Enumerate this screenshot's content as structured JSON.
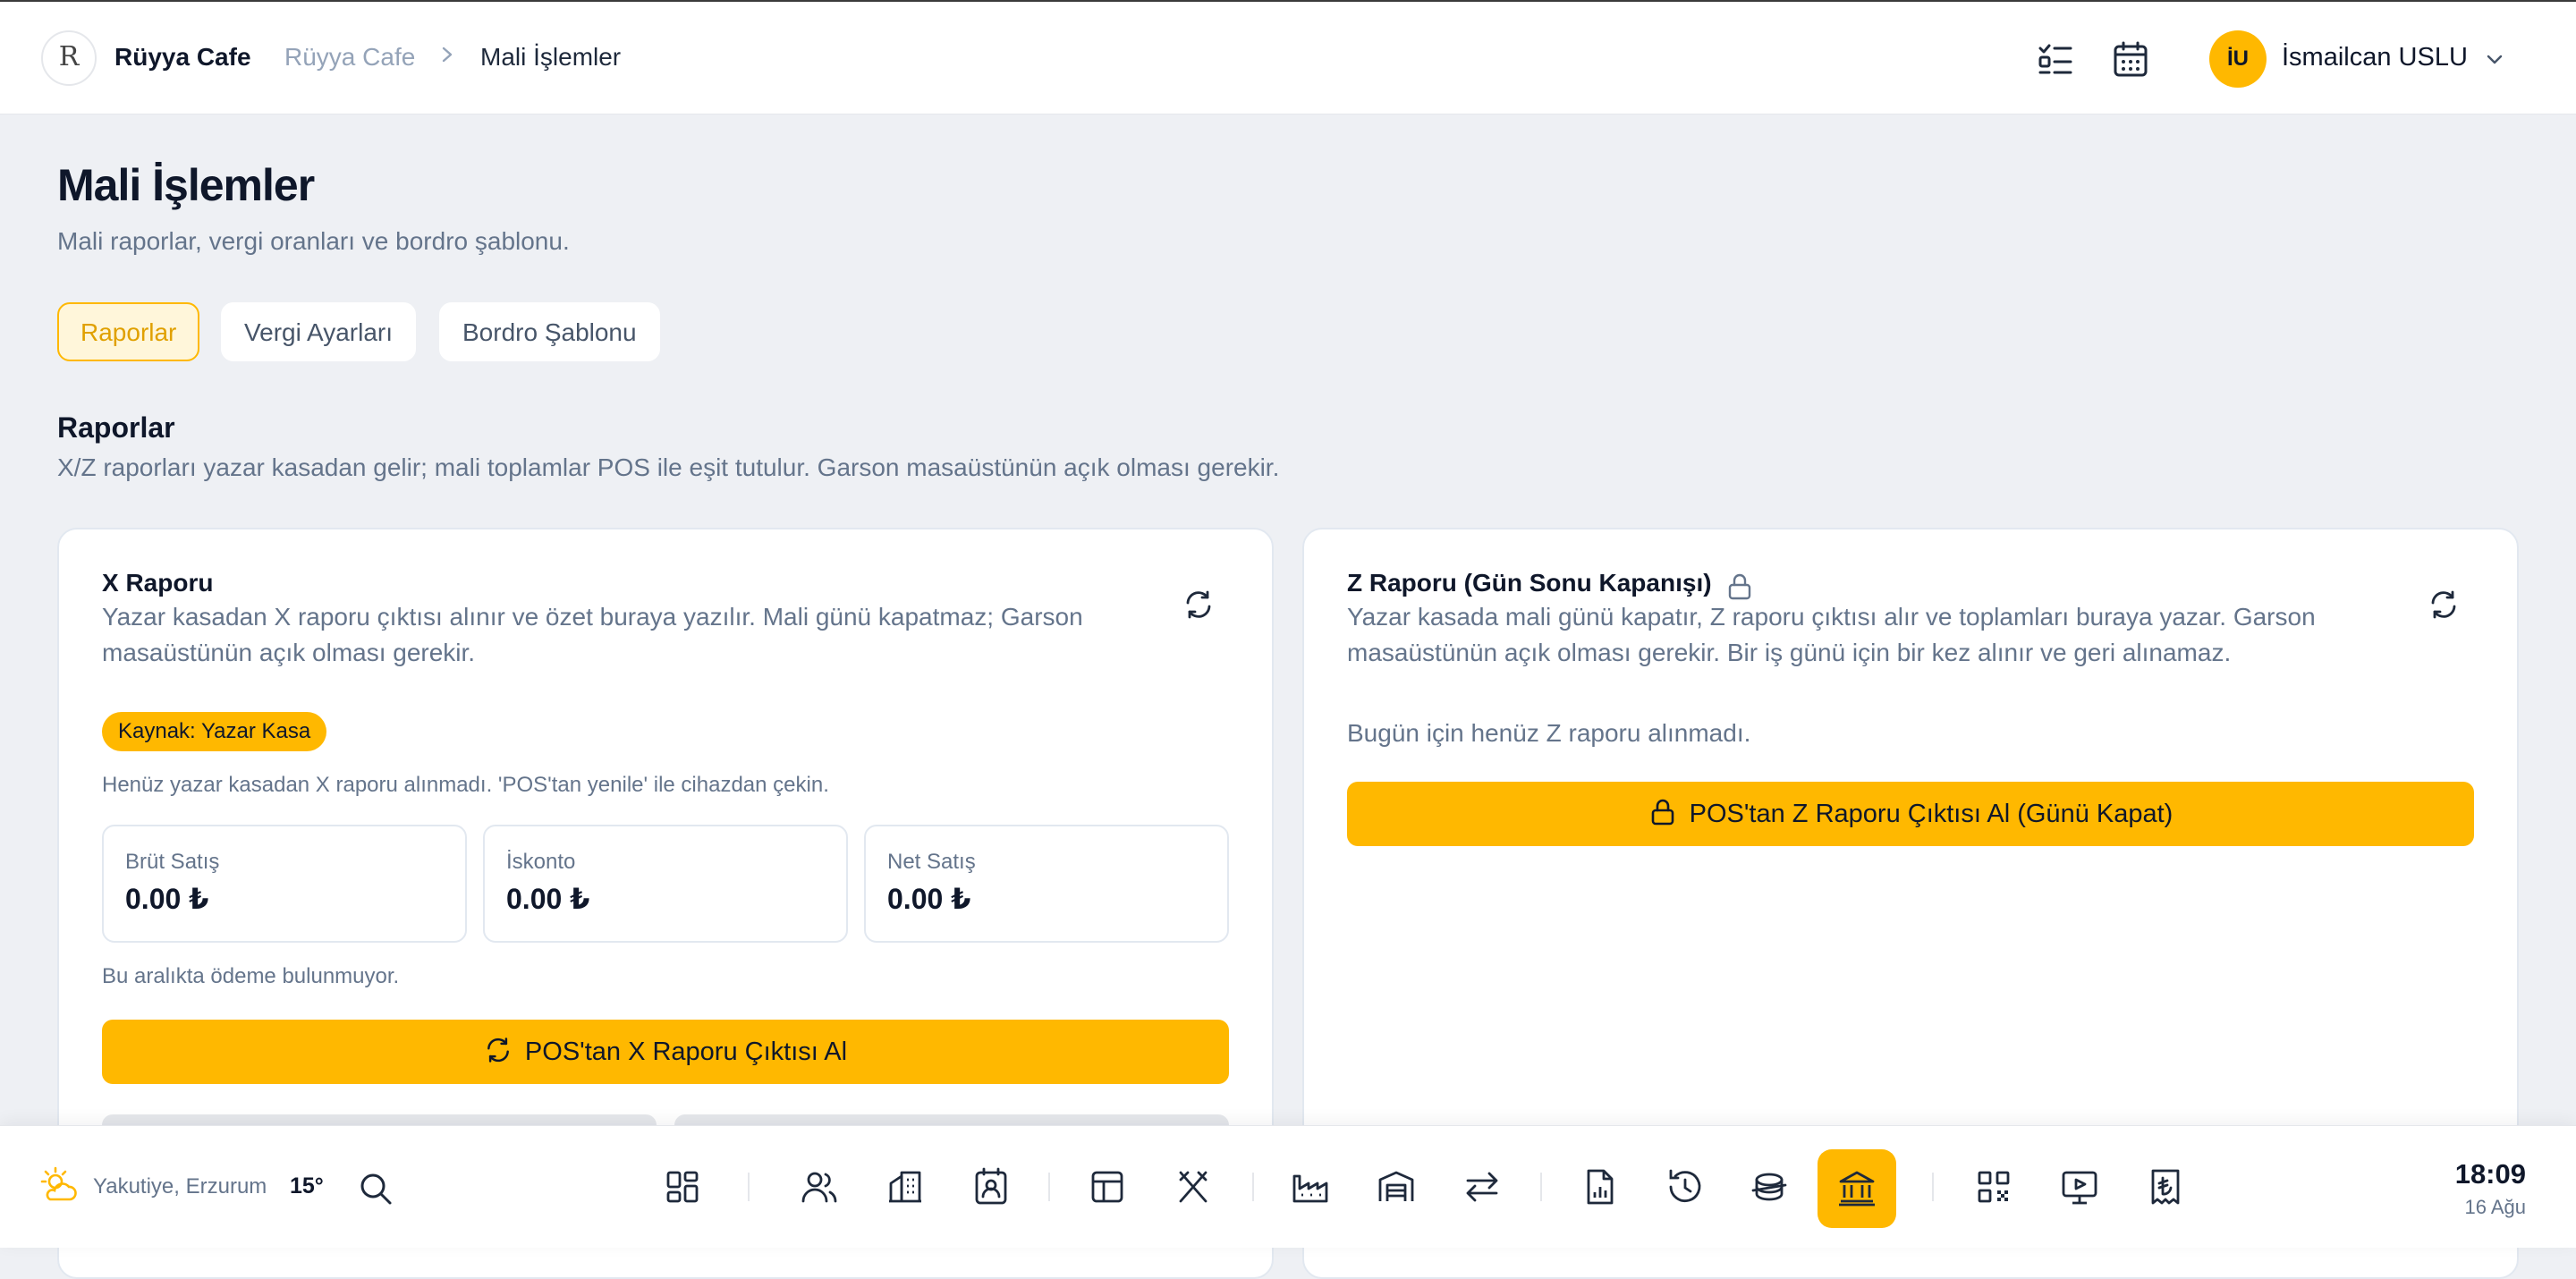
{
  "header": {
    "brand": "Rüyya Cafe",
    "logo_letter": "R",
    "breadcrumb": [
      "Rüyya Cafe",
      "Mali İşlemler"
    ],
    "user_initials": "İU",
    "user_name": "İsmailcan USLU",
    "icons": [
      "checklist-icon",
      "calendar-icon",
      "chevron-down-icon"
    ]
  },
  "page": {
    "title": "Mali İşlemler",
    "subtitle": "Mali raporlar, vergi oranları ve bordro şablonu."
  },
  "tabs": [
    {
      "label": "Raporlar",
      "active": true
    },
    {
      "label": "Vergi Ayarları",
      "active": false
    },
    {
      "label": "Bordro Şablonu",
      "active": false
    }
  ],
  "section": {
    "title": "Raporlar",
    "subtitle": "X/Z raporları yazar kasadan gelir; mali toplamlar POS ile eşit tutulur. Garson masaüstünün açık olması gerekir."
  },
  "x_report": {
    "title": "X Raporu",
    "description": "Yazar kasadan X raporu çıktısı alınır ve özet buraya yazılır. Mali günü kapatmaz; Garson masaüstünün açık olması gerekir.",
    "badge": "Kaynak: Yazar Kasa",
    "info": "Henüz yazar kasadan X raporu alınmadı. 'POS'tan yenile' ile cihazdan çekin.",
    "stats": [
      {
        "label": "Brüt Satış",
        "value": "0.00 ₺"
      },
      {
        "label": "İskonto",
        "value": "0.00 ₺"
      },
      {
        "label": "Net Satış",
        "value": "0.00 ₺"
      }
    ],
    "empty": "Bu aralıkta ödeme bulunmuyor.",
    "button": "POS'tan X Raporu Çıktısı Al"
  },
  "z_report": {
    "title": "Z Raporu (Gün Sonu Kapanışı)",
    "description": "Yazar kasada mali günü kapatır, Z raporu çıktısı alır ve toplamları buraya yazar. Garson masaüstünün açık olması gerekir. Bir iş günü için bir kez alınır ve geri alınamaz.",
    "empty": "Bugün için henüz Z raporu alınmadı.",
    "button": "POS'tan Z Raporu Çıktısı Al (Günü Kapat)"
  },
  "footer": {
    "location": "Yakutiye, Erzurum",
    "temperature": "15°",
    "time": "18:09",
    "date": "16 Ağu",
    "dock_icons": [
      "dashboard-icon",
      "users-icon",
      "building-icon",
      "contact-icon",
      "table-layout-icon",
      "utensils-icon",
      "factory-icon",
      "warehouse-icon",
      "transfer-icon",
      "report-file-icon",
      "history-icon",
      "coins-icon",
      "bank-icon",
      "qr-code-icon",
      "monitor-play-icon",
      "lira-receipt-icon"
    ],
    "active_dock_icon": "bank-icon"
  },
  "colors": {
    "accent": "#ffb800",
    "background": "#eef0f4",
    "text": "#0f172a",
    "muted": "#64748b"
  }
}
